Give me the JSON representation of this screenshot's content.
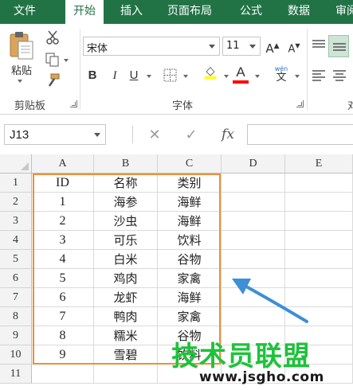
{
  "ribbon_tabs": [
    "文件",
    "开始",
    "插入",
    "页面布局",
    "公式",
    "数据",
    "审阅"
  ],
  "active_tab": "开始",
  "clipboard": {
    "paste_label": "粘贴",
    "group_label": "剪贴板"
  },
  "font": {
    "name": "宋体",
    "size": "11",
    "group_label": "字体",
    "bold": "B",
    "italic": "I",
    "underline": "U",
    "font_color": "A",
    "phonetic_top": "wén",
    "phonetic_bottom": "文",
    "highlight_color": "#ffff00",
    "font_color_hex": "#ff0000"
  },
  "alignment": {
    "group_label_partial": "对"
  },
  "formula_bar": {
    "name_box": "J13",
    "fx_label": "fx",
    "formula": ""
  },
  "columns": [
    "A",
    "B",
    "C",
    "D",
    "E"
  ],
  "rows": [
    "1",
    "2",
    "3",
    "4",
    "5",
    "6",
    "7",
    "8",
    "9",
    "10",
    "11"
  ],
  "table": [
    [
      "ID",
      "名称",
      "类别"
    ],
    [
      "1",
      "海参",
      "海鲜"
    ],
    [
      "2",
      "沙虫",
      "海鲜"
    ],
    [
      "3",
      "可乐",
      "饮料"
    ],
    [
      "4",
      "白米",
      "谷物"
    ],
    [
      "5",
      "鸡肉",
      "家禽"
    ],
    [
      "6",
      "龙虾",
      "海鲜"
    ],
    [
      "7",
      "鸭肉",
      "家禽"
    ],
    [
      "8",
      "糯米",
      "谷物"
    ],
    [
      "9",
      "雪碧",
      "饮料"
    ]
  ],
  "colors": {
    "ribbon_green": "#217346",
    "highlight_box": "#ed8e3a",
    "arrow_blue": "#3d8fd6",
    "watermark_green": "#1fc23b"
  },
  "watermark": {
    "main": "技术员联盟",
    "sub": "www.jsgho.com"
  }
}
